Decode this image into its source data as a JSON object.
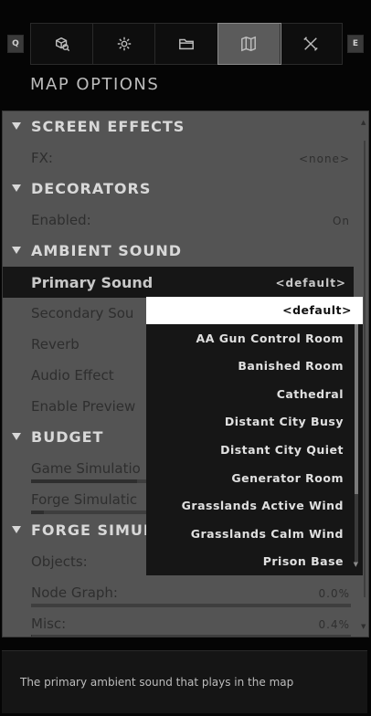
{
  "tabbar": {
    "left_key": "Q",
    "right_key": "E",
    "tabs": [
      {
        "icon": "objects-search-icon"
      },
      {
        "icon": "gear-icon"
      },
      {
        "icon": "folder-icon"
      },
      {
        "icon": "map-icon",
        "active": true
      },
      {
        "icon": "tools-icon"
      }
    ]
  },
  "title": "MAP OPTIONS",
  "sections": {
    "screen_effects": "SCREEN EFFECTS",
    "decorators": "DECORATORS",
    "ambient_sound": "AMBIENT SOUND",
    "budget": "BUDGET",
    "forge_simulation": "FORGE SIMULA"
  },
  "items": {
    "fx": {
      "label": "FX:",
      "value": "<none>"
    },
    "enabled": {
      "label": "Enabled:",
      "value": "On"
    },
    "primary_sound": {
      "label": "Primary Sound",
      "value": "<default>"
    },
    "secondary_sound": {
      "label": "Secondary Sou"
    },
    "reverb": {
      "label": "Reverb"
    },
    "audio_effect": {
      "label": "Audio Effect"
    },
    "enable_preview": {
      "label": "Enable Preview"
    },
    "game_simulation": {
      "label": "Game Simulatio",
      "fill": 0.33
    },
    "forge_simulation": {
      "label": "Forge Simulatic",
      "fill": 0.04
    },
    "objects": {
      "label": "Objects:"
    },
    "node_graph": {
      "label": "Node Graph:",
      "value": "0.0%",
      "fill": 0.0
    },
    "misc": {
      "label": "Misc:",
      "value": "0.4%",
      "fill": 0.004
    }
  },
  "dropdown": {
    "options": [
      "<default>",
      "AA Gun Control Room",
      "Banished Room",
      "Cathedral",
      "Distant City Busy",
      "Distant City Quiet",
      "Generator Room",
      "Grasslands Active Wind",
      "Grasslands Calm Wind",
      "Prison Base"
    ],
    "selected_index": 0
  },
  "footer": {
    "description": "The primary ambient sound that plays in the map"
  },
  "colors": {
    "panel_bg": "#545454",
    "selected_row_bg": "#161616",
    "dropdown_bg": "#161616",
    "highlight": "#ffffff"
  }
}
